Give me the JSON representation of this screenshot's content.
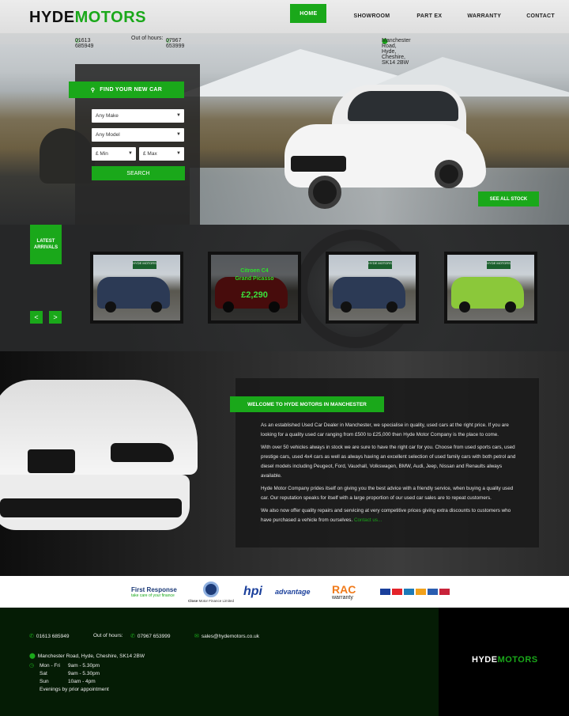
{
  "brand": {
    "part1": "HYDE",
    "part2": "MOTORS"
  },
  "nav": {
    "items": [
      "HOME",
      "SHOWROOM",
      "PART EX",
      "WARRANTY",
      "CONTACT"
    ],
    "active_index": 0
  },
  "info": {
    "phone": "01613 685949",
    "out_label": "Out of hours:",
    "out_phone": "07967 653999",
    "address": "Manchester Road, Hyde, Cheshire, SK14 2BW"
  },
  "finder": {
    "title": "FIND YOUR NEW CAR",
    "make": "Any Make",
    "model": "Any Model",
    "min": "£ Min",
    "max": "£ Max",
    "search": "SEARCH"
  },
  "hero": {
    "see_all": "SEE ALL STOCK"
  },
  "arrivals": {
    "label_line1": "LATEST",
    "label_line2": "ARRIVALS",
    "prev": "<",
    "next": ">",
    "cards": [
      {
        "sign": "HYDE MOTORS",
        "color": "#2c3a55"
      },
      {
        "sign": "",
        "color": "#9e1b1b",
        "title": "Citroen C4",
        "subtitle": "Grand Picasso",
        "price": "£2,290"
      },
      {
        "sign": "HYDE MOTORS",
        "color": "#2c3a55"
      },
      {
        "sign": "HYDE MOTORS",
        "color": "#8bc83a"
      }
    ]
  },
  "welcome": {
    "title": "WELCOME TO HYDE MOTORS IN MANCHESTER",
    "p1": "As an established Used Car Dealer in Manchester, we specialise in quality, used cars at the right price. If you are looking for a quality used car ranging from £500 to £25,000 then Hyde Motor Company is the place to come.",
    "p2": "With over 50 vehicles always in stock we are sure to have the right car for you. Choose from used sports cars, used prestige cars, used 4x4 cars as well as always having an excellent selection of used family cars with both petrol and diesel models including Peugeot, Ford, Vauxhall, Volkswagen, BMW, Audi, Jeep, Nissan and Renaults always available.",
    "p3": "Hyde Motor Company prides itself on giving you the best advice with a friendly service, when buying a quality used car. Our reputation speaks for itself with a large proportion of our used car sales are to repeat customers.",
    "p4": "We also now offer quality repairs and servicing at very competitive prices giving extra discounts to customers who have purchased a vehicle from ourselves.",
    "link": "Contact us..."
  },
  "partners": {
    "first_response": "First Response",
    "first_tag": "take care of your finance",
    "close": "Close",
    "close_tag": "Motor Finance Limited",
    "hpi": "hpi",
    "advantage": "advantage",
    "rac": "RAC",
    "rac_sub": "warranty"
  },
  "footer": {
    "phone": "01613 685949",
    "out_label": "Out of hours:",
    "out_phone": "07967 653999",
    "email": "sales@hydemotors.co.uk",
    "address": "Manchester Road, Hyde, Cheshire, SK14 2BW",
    "hours": [
      {
        "day": "Mon - Fri",
        "time": "9am - 5.30pm"
      },
      {
        "day": "Sat",
        "time": "9am - 5.30pm"
      },
      {
        "day": "Sun",
        "time": "10am - 4pm"
      }
    ],
    "note": "Evenings by prior appointment"
  },
  "colors": {
    "accent": "#1aa81a",
    "dark": "#051c05"
  }
}
